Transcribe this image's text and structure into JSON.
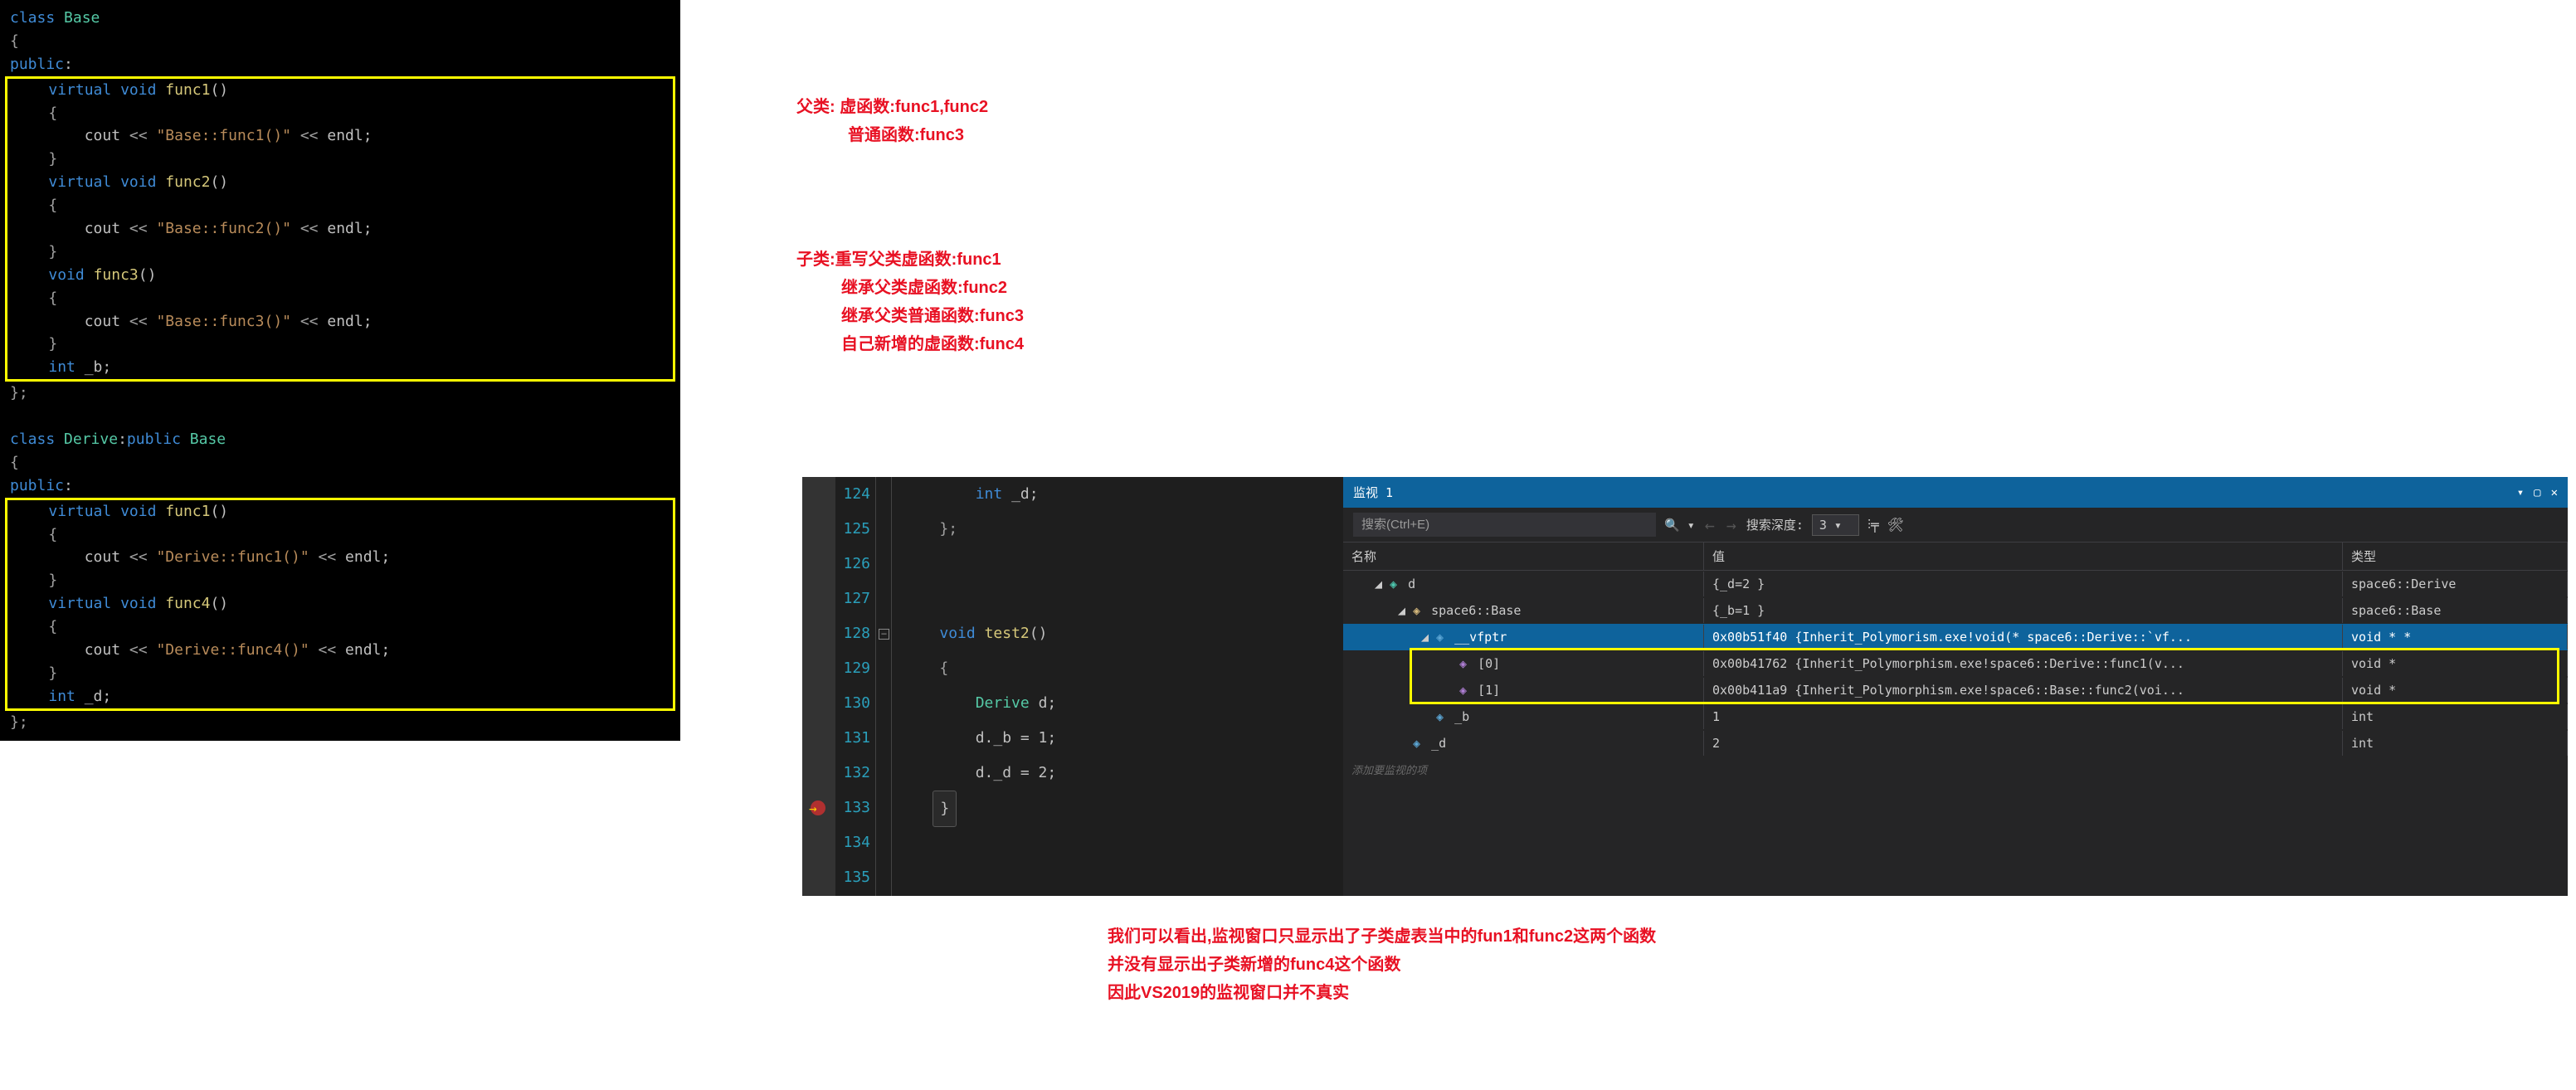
{
  "leftCode": {
    "base": {
      "classKw": "class",
      "baseName": "Base",
      "publicKw": "public",
      "virtualKw": "virtual",
      "voidKw": "void",
      "intKw": "int",
      "func1": "func1",
      "func2": "func2",
      "func3": "func3",
      "coutKw": "cout",
      "endlKw": "endl",
      "op": "<<",
      "s1": "\"Base::func1()\"",
      "s2": "\"Base::func2()\"",
      "s3": "\"Base::func3()\"",
      "memberB": "_b"
    },
    "derive": {
      "classKw": "class",
      "deriveName": "Derive",
      "publicKw": "public",
      "baseName": "Base",
      "virtualKw": "virtual",
      "voidKw": "void",
      "intKw": "int",
      "func1": "func1",
      "func4": "func4",
      "coutKw": "cout",
      "endlKw": "endl",
      "op": "<<",
      "s1": "\"Derive::func1()\"",
      "s4": "\"Derive::func4()\"",
      "memberD": "_d"
    }
  },
  "notes1": {
    "l1": "父类: 虚函数:func1,func2",
    "l2": "普通函数:func3"
  },
  "notes2": {
    "l1": "子类:重写父类虚函数:func1",
    "l2": "继承父类虚函数:func2",
    "l3": "继承父类普通函数:func3",
    "l4": "自己新增的虚函数:func4"
  },
  "notes3": {
    "l1": "我们可以看出,监视窗口只显示出了子类虚表当中的fun1和func2这两个函数",
    "l2": "并没有显示出子类新增的func4这个函数",
    "l3": "因此VS2019的监视窗口并不真实"
  },
  "dbg": {
    "lines": [
      "124",
      "125",
      "126",
      "127",
      "128",
      "129",
      "130",
      "131",
      "132",
      "133",
      "134",
      "135"
    ],
    "intKw": "int",
    "memD": "_d",
    "semi": ";",
    "brC": "}",
    "voidKw": "void",
    "test2": "test2",
    "brO": "{",
    "deriveT": "Derive",
    "dVar": "d",
    "l131": "d._b = 1;",
    "l132": "d._d = 2;",
    "l133": "}"
  },
  "watch": {
    "title": "监视 1",
    "searchPh": "搜索(Ctrl+E)",
    "depthLabel": "搜索深度:",
    "depthVal": "3",
    "hdr": {
      "name": "名称",
      "val": "值",
      "type": "类型"
    },
    "rows": [
      {
        "ind": 1,
        "tri": "◢",
        "ico": "cube",
        "name": "d",
        "val": "{_d=2 }",
        "type": "space6::Derive"
      },
      {
        "ind": 2,
        "tri": "◢",
        "ico": "cubey",
        "name": "space6::Base",
        "val": "{_b=1 }",
        "type": "space6::Base"
      },
      {
        "ind": 3,
        "tri": "◢",
        "ico": "cubeb",
        "name": "__vfptr",
        "val": "0x00b51f40 {Inherit_Polymorism.exe!void(* space6::Derive::`vf...",
        "type": "void * *",
        "sel": true
      },
      {
        "ind": 4,
        "tri": "",
        "ico": "cubep",
        "name": "[0]",
        "val": "0x00b41762 {Inherit_Polymorphism.exe!space6::Derive::func1(v...",
        "type": "void *"
      },
      {
        "ind": 4,
        "tri": "",
        "ico": "cubep",
        "name": "[1]",
        "val": "0x00b411a9 {Inherit_Polymorphism.exe!space6::Base::func2(voi...",
        "type": "void *"
      },
      {
        "ind": 3,
        "tri": "",
        "ico": "cubeb",
        "name": "_b",
        "val": "1",
        "type": "int"
      },
      {
        "ind": 2,
        "tri": "",
        "ico": "cubeb",
        "name": "_d",
        "val": "2",
        "type": "int"
      }
    ],
    "placeholder": "添加要监视的项"
  }
}
